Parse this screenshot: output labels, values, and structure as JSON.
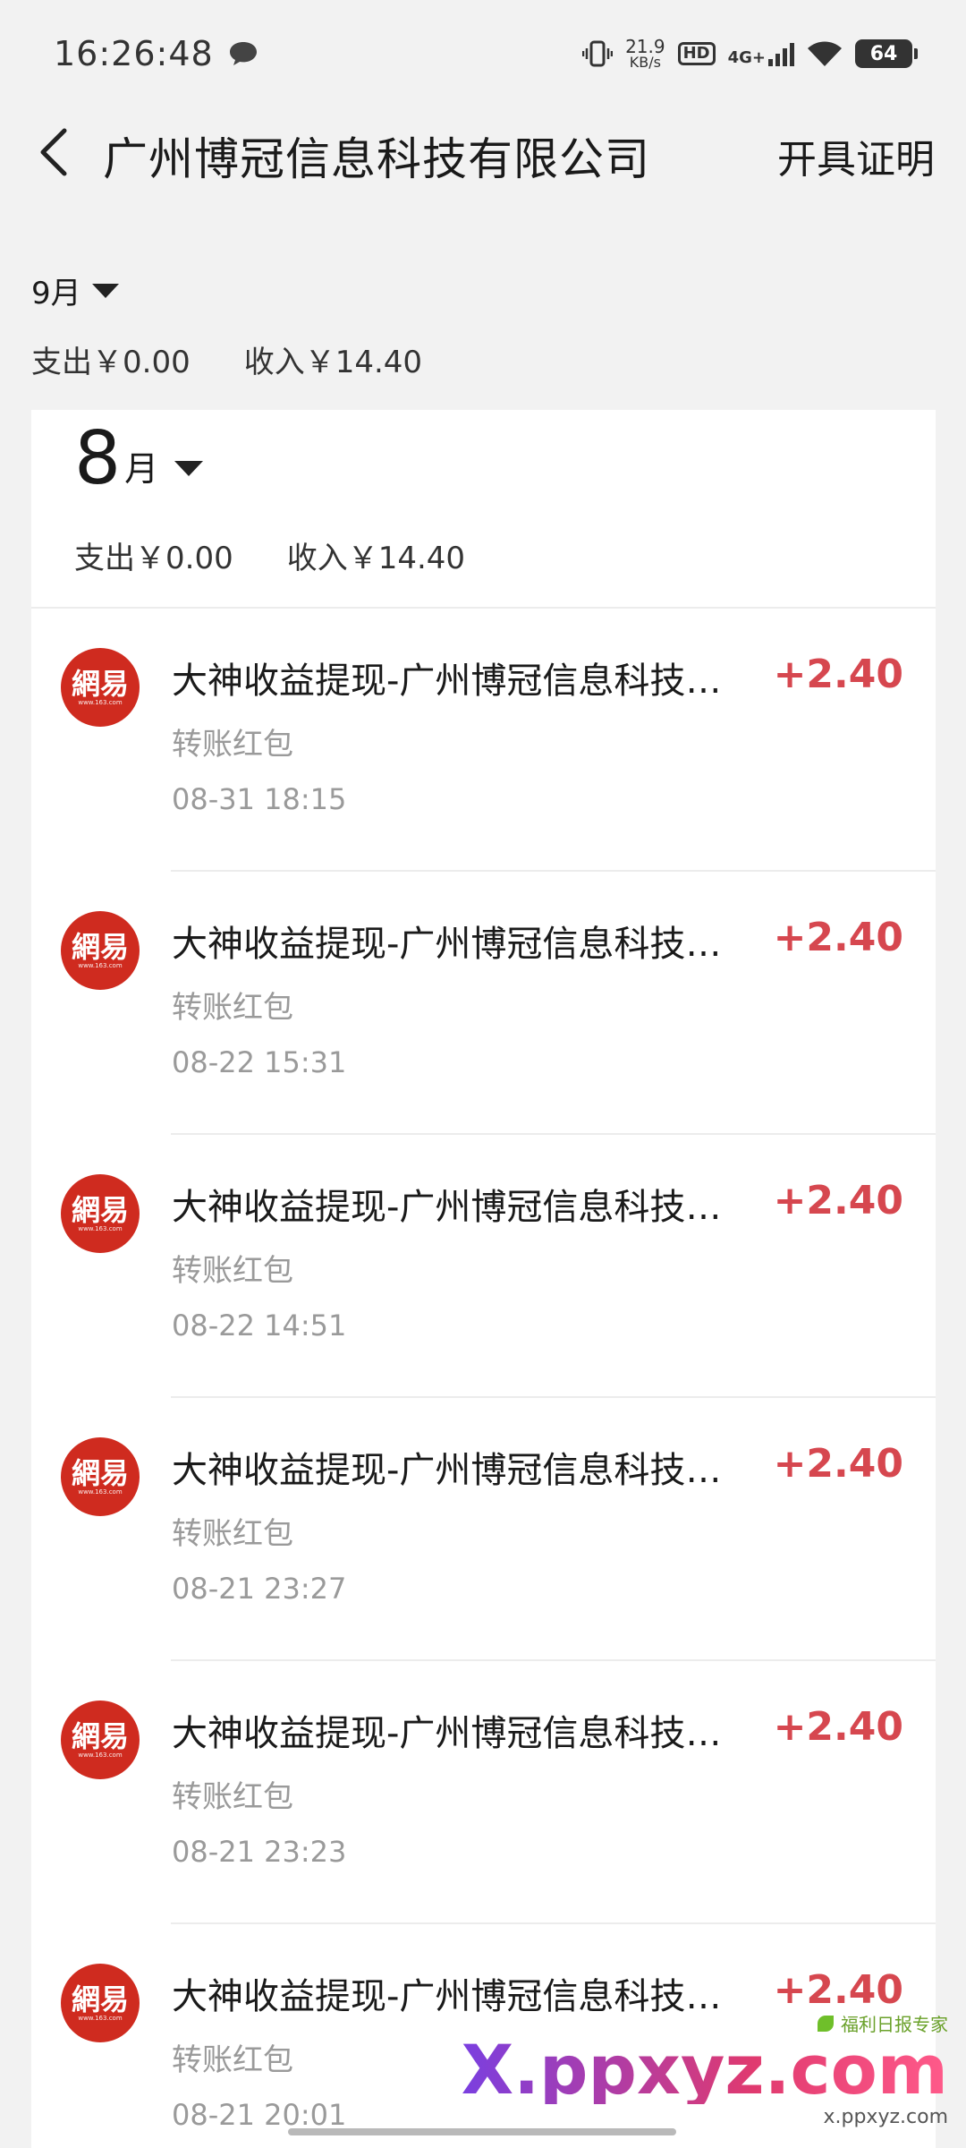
{
  "status_bar": {
    "time": "16:26:48",
    "net_speed_value": "21.9",
    "net_speed_unit": "KB/s",
    "hd": "HD",
    "network": "4G+",
    "battery": "64"
  },
  "header": {
    "title": "广州博冠信息科技有限公司",
    "action": "开具证明"
  },
  "sticky_summary": {
    "month": "9月",
    "expense": "支出￥0.00",
    "income": "收入￥14.40"
  },
  "month_card": {
    "month_num": "8",
    "month_unit": "月",
    "expense": "支出￥0.00",
    "income": "收入￥14.40"
  },
  "transactions": [
    {
      "logo": "網易",
      "logo_sub": "www.163.com",
      "title": "大神收益提现-广州博冠信息科技有限公司",
      "type": "转账红包",
      "time": "08-31 18:15",
      "amount": "+2.40"
    },
    {
      "logo": "網易",
      "logo_sub": "www.163.com",
      "title": "大神收益提现-广州博冠信息科技有限公司",
      "type": "转账红包",
      "time": "08-22 15:31",
      "amount": "+2.40"
    },
    {
      "logo": "網易",
      "logo_sub": "www.163.com",
      "title": "大神收益提现-广州博冠信息科技有限公司",
      "type": "转账红包",
      "time": "08-22 14:51",
      "amount": "+2.40"
    },
    {
      "logo": "網易",
      "logo_sub": "www.163.com",
      "title": "大神收益提现-广州博冠信息科技有限公司",
      "type": "转账红包",
      "time": "08-21 23:27",
      "amount": "+2.40"
    },
    {
      "logo": "網易",
      "logo_sub": "www.163.com",
      "title": "大神收益提现-广州博冠信息科技有限公司",
      "type": "转账红包",
      "time": "08-21 23:23",
      "amount": "+2.40"
    },
    {
      "logo": "網易",
      "logo_sub": "www.163.com",
      "title": "大神收益提现-广州博冠信息科技有限公司",
      "type": "转账红包",
      "time": "08-21 20:01",
      "amount": "+2.40"
    }
  ],
  "watermark": {
    "tag": "福利日报专家",
    "main": "X.ppxyz.com",
    "sub": "x.ppxyz.com"
  },
  "colors": {
    "background": "#f2f2f2",
    "card": "#ffffff",
    "income_red": "#d6474f",
    "logo_red": "#cf2b1f",
    "muted_text": "#9a9a9a"
  }
}
